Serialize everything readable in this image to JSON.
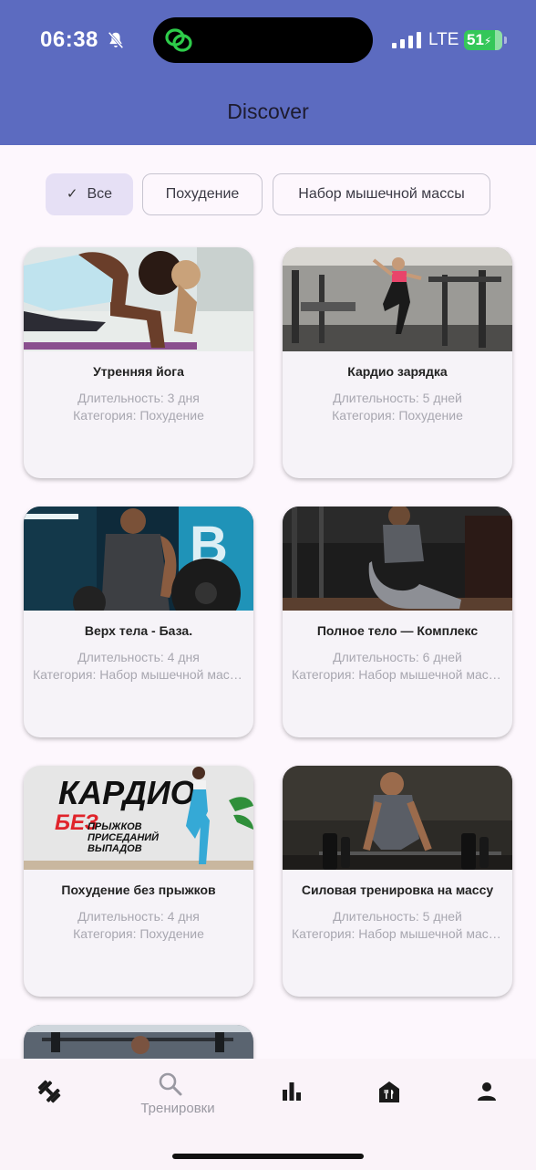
{
  "status_bar": {
    "time": "06:38",
    "network": "LTE",
    "battery": "51"
  },
  "header": {
    "title": "Discover"
  },
  "filters": [
    {
      "label": "Все",
      "selected": true
    },
    {
      "label": "Похудение",
      "selected": false
    },
    {
      "label": "Набор мышечной массы",
      "selected": false
    }
  ],
  "workouts": [
    {
      "title": "Утренняя йога",
      "duration": "Длительность: 3 дня",
      "category": "Категория: Похудение"
    },
    {
      "title": "Кардио зарядка",
      "duration": "Длительность: 5 дней",
      "category": "Категория: Похудение"
    },
    {
      "title": "Верх тела - База.",
      "duration": "Длительность: 4 дня",
      "category": "Категория: Набор мышечной массы"
    },
    {
      "title": "Полное тело — Комплекс",
      "duration": "Длительность: 6 дней",
      "category": "Категория: Набор мышечной массы"
    },
    {
      "title": "Похудение без прыжков",
      "duration": "Длительность: 4 дня",
      "category": "Категория: Похудение",
      "image_text": [
        "КАРДИО",
        "БЕЗ",
        "ПРЫЖКОВ",
        "ПРИСЕДАНИЙ",
        "ВЫПАДОВ"
      ]
    },
    {
      "title": "Силовая тренировка на массу",
      "duration": "Длительность: 5 дней",
      "category": "Категория: Набор мышечной массы"
    }
  ],
  "bottom_nav": [
    {
      "icon": "dumbbell-icon",
      "label": ""
    },
    {
      "icon": "search-icon",
      "label": "Тренировки"
    },
    {
      "icon": "bar-chart-icon",
      "label": ""
    },
    {
      "icon": "restaurant-icon",
      "label": ""
    },
    {
      "icon": "person-icon",
      "label": ""
    }
  ],
  "colors": {
    "header": "#5c6bc0",
    "chip_selected": "#e6e0f5",
    "background": "#fdf7fd"
  }
}
